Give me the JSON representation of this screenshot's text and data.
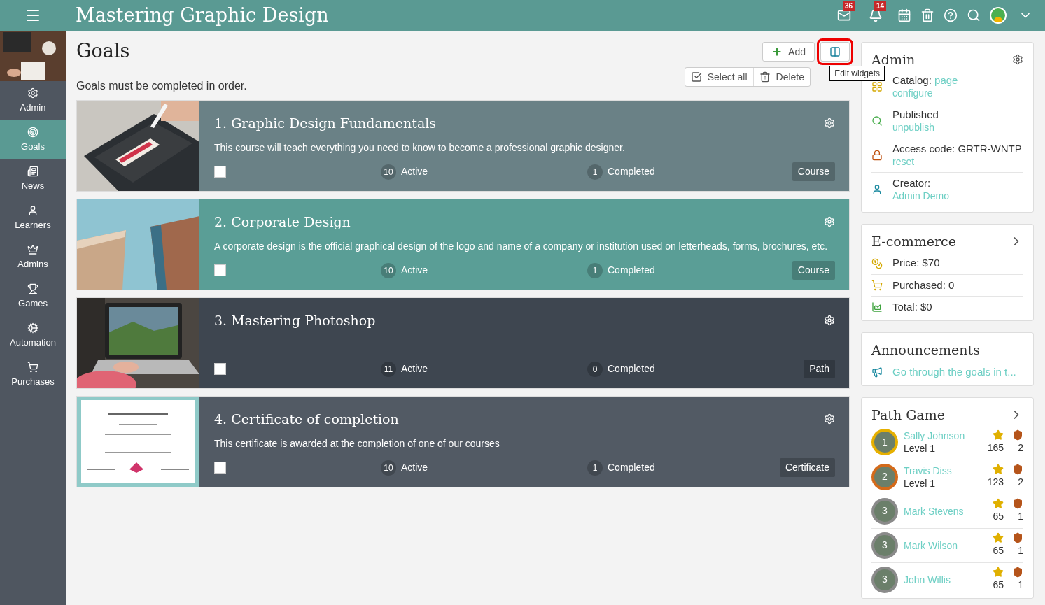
{
  "topbar": {
    "title": "Mastering Graphic Design",
    "mail_count": "36",
    "notification_count": "14"
  },
  "sidebar": {
    "items": [
      {
        "label": "Admin",
        "selected": false
      },
      {
        "label": "Goals",
        "selected": true
      },
      {
        "label": "News",
        "selected": false
      },
      {
        "label": "Learners",
        "selected": false
      },
      {
        "label": "Admins",
        "selected": false
      },
      {
        "label": "Games",
        "selected": false
      },
      {
        "label": "Automation",
        "selected": false
      },
      {
        "label": "Purchases",
        "selected": false
      }
    ]
  },
  "page": {
    "title": "Goals",
    "note": "Goals must be completed in order.",
    "add_button": "Add",
    "tooltip": "Edit widgets",
    "select_all": "Select all",
    "delete": "Delete"
  },
  "goals": [
    {
      "title": "1. Graphic Design Fundamentals",
      "description": "This course will teach everything you need to know to become a professional graphic designer.",
      "active_count": "10",
      "active_label": "Active",
      "completed_count": "1",
      "completed_label": "Completed",
      "type": "Course",
      "color": "#6a8186",
      "checked": false
    },
    {
      "title": "2. Corporate Design",
      "description": "A corporate design is the official graphical design of the logo and name of a company or institution used on letterheads, forms, brochures, etc.",
      "active_count": "10",
      "active_label": "Active",
      "completed_count": "1",
      "completed_label": "Completed",
      "type": "Course",
      "color": "#5a9e96",
      "checked": false
    },
    {
      "title": "3. Mastering Photoshop",
      "active_count": "11",
      "active_label": "Active",
      "completed_count": "0",
      "completed_label": "Completed",
      "type": "Path",
      "color": "#3e4650",
      "checked": false
    },
    {
      "title": "4. Certificate of completion",
      "description": "This certificate is awarded at the completion of one of our courses",
      "active_count": "10",
      "active_label": "Active",
      "completed_count": "1",
      "completed_label": "Completed",
      "type": "Certificate",
      "color": "#525a64",
      "checked": false
    }
  ],
  "admin_widget": {
    "title": "Admin",
    "rows": [
      {
        "text": "Catalog: ",
        "link": "page",
        "sublink": "configure"
      },
      {
        "text": "Published",
        "sublink": "unpublish"
      },
      {
        "text": "Access code: GRTR-WNTP",
        "sublink": "reset"
      },
      {
        "text": "Creator:",
        "sublink": "Admin Demo"
      }
    ]
  },
  "ecommerce": {
    "title": "E-commerce",
    "rows": [
      {
        "text": "Price: $70"
      },
      {
        "text": "Purchased: 0"
      },
      {
        "text": "Total: $0"
      }
    ]
  },
  "announcements": {
    "title": "Announcements",
    "items": [
      "Go through the goals in t..."
    ]
  },
  "path_game": {
    "title": "Path Game",
    "players": [
      {
        "rank": "1",
        "name": "Sally Johnson",
        "level": "Level 1",
        "points": "165",
        "badges": "2",
        "color": "#e6b000"
      },
      {
        "rank": "2",
        "name": "Travis Diss",
        "level": "Level 1",
        "points": "123",
        "badges": "2",
        "color": "#d46a1a"
      },
      {
        "rank": "3",
        "name": "Mark Stevens",
        "points": "65",
        "badges": "1",
        "color": "#8a8a8a"
      },
      {
        "rank": "3",
        "name": "Mark Wilson",
        "points": "65",
        "badges": "1",
        "color": "#8a8a8a"
      },
      {
        "rank": "3",
        "name": "John Willis",
        "points": "65",
        "badges": "1",
        "color": "#8a8a8a"
      }
    ]
  }
}
